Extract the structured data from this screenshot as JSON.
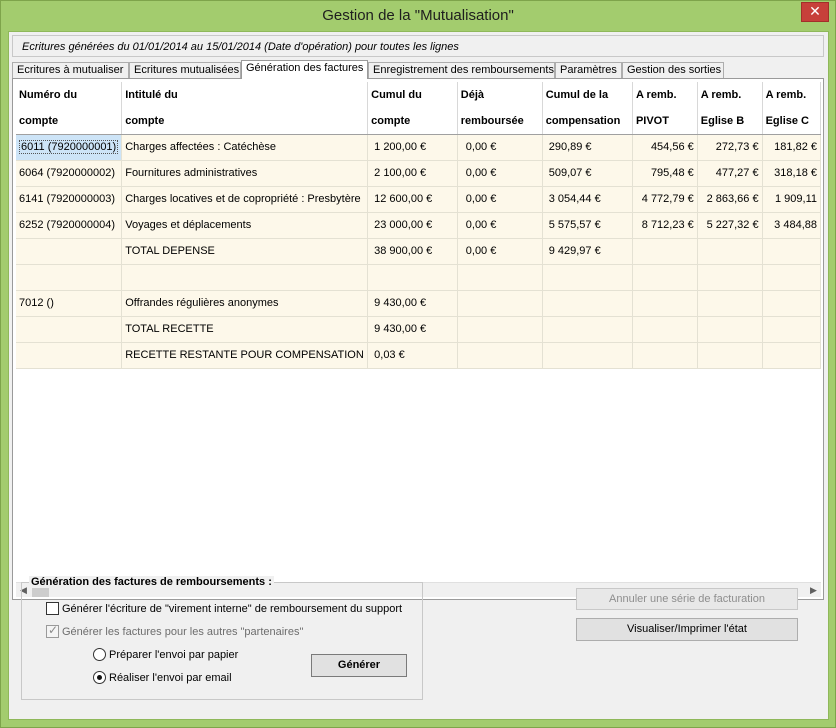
{
  "window": {
    "title": "Gestion de la \"Mutualisation\"",
    "close_label": "✕"
  },
  "info": "Ecritures générées du 01/01/2014 au 15/01/2014 (Date d'opération) pour toutes les lignes",
  "tabs": [
    "Ecritures à mutualiser",
    "Ecritures mutualisées",
    "Génération des factures",
    "Enregistrement des remboursements",
    "Paramètres",
    "Gestion des sorties"
  ],
  "grid": {
    "headers": [
      [
        "Numéro du",
        "compte"
      ],
      [
        "Intitulé du",
        "compte"
      ],
      [
        "Cumul du",
        "compte"
      ],
      [
        "Déjà",
        "remboursée"
      ],
      [
        "Cumul de la",
        "compensation"
      ],
      [
        "A remb.",
        "PIVOT"
      ],
      [
        "A remb.",
        "Eglise B"
      ],
      [
        "A remb.",
        "Eglise C"
      ]
    ],
    "rows": [
      [
        "6011 (7920000001)",
        "Charges affectées : Catéchèse",
        "1 200,00 €",
        "0,00 €",
        "290,89 €",
        "454,56 €",
        "272,73 €",
        "181,82 €"
      ],
      [
        "6064 (7920000002)",
        "Fournitures administratives",
        "2 100,00 €",
        "0,00 €",
        "509,07 €",
        "795,48 €",
        "477,27 €",
        "318,18 €"
      ],
      [
        "6141 (7920000003)",
        "Charges locatives et de copropriété : Presbytère",
        "12 600,00 €",
        "0,00 €",
        "3 054,44 €",
        "4 772,79 €",
        "2 863,66 €",
        "1 909,11"
      ],
      [
        "6252 (7920000004)",
        "Voyages et déplacements",
        "23 000,00 €",
        "0,00 €",
        "5 575,57 €",
        "8 712,23 €",
        "5 227,32 €",
        "3 484,88"
      ],
      [
        "",
        "TOTAL DEPENSE",
        "38 900,00 €",
        "0,00 €",
        "9 429,97 €",
        "",
        "",
        ""
      ],
      [
        "",
        "",
        "",
        "",
        "",
        "",
        "",
        ""
      ],
      [
        "7012 ()",
        "Offrandes régulières anonymes",
        "9 430,00 €",
        "",
        "",
        "",
        "",
        ""
      ],
      [
        "",
        "TOTAL RECETTE",
        "9 430,00 €",
        "",
        "",
        "",
        "",
        ""
      ],
      [
        "",
        "RECETTE RESTANTE POUR COMPENSATION",
        "0,03 €",
        "",
        "",
        "",
        "",
        ""
      ]
    ]
  },
  "scroll": {
    "left": "◀",
    "right": "▶"
  },
  "generation": {
    "title": "Génération des factures de remboursements :",
    "opt_virement": "Générer l'écriture de \"virement interne\" de remboursement du support",
    "opt_factures": "Générer les factures pour les autres \"partenaires\"",
    "radio_papier": "Préparer l'envoi par papier",
    "radio_email": "Réaliser l'envoi par email",
    "generate_label": "Générer"
  },
  "actions": {
    "cancel_series": "Annuler une série de facturation",
    "print_state": "Visualiser/Imprimer l'état"
  }
}
